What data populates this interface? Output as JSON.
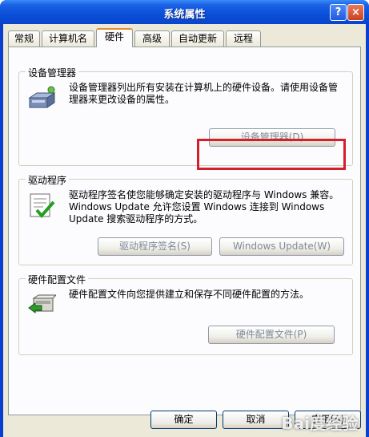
{
  "window": {
    "title": "系统属性",
    "help_label": "?",
    "close_label": "×"
  },
  "tabs": [
    {
      "label": "常规"
    },
    {
      "label": "计算机名"
    },
    {
      "label": "硬件",
      "active": true
    },
    {
      "label": "高级"
    },
    {
      "label": "自动更新"
    },
    {
      "label": "远程"
    }
  ],
  "device_manager": {
    "title": "设备管理器",
    "icon": "device-manager-icon",
    "description": "设备管理器列出所有安装在计算机上的硬件设备。请使用设备管理器来更改设备的属性。",
    "button_label": "设备管理器(D)"
  },
  "drivers": {
    "title": "驱动程序",
    "icon": "driver-signing-icon",
    "description": "驱动程序签名使您能够确定安装的驱动程序与 Windows 兼容。Windows Update 允许您设置 Windows 连接到 Windows Update 搜索驱动程序的方式。",
    "signing_button_label": "驱动程序签名(S)",
    "update_button_label": "Windows Update(W)"
  },
  "hardware_profiles": {
    "title": "硬件配置文件",
    "icon": "hardware-profiles-icon",
    "description": "硬件配置文件向您提供建立和保存不同硬件配置的方法。",
    "button_label": "硬件配置文件(P)"
  },
  "footer": {
    "ok_label": "确定",
    "cancel_label": "取消",
    "apply_label": "应用(A)"
  },
  "watermark": "Bai度经验",
  "colors": {
    "titlebar": "#0b4fd8",
    "highlight": "#d4202a",
    "active_tab_accent": "#e68b2c"
  }
}
